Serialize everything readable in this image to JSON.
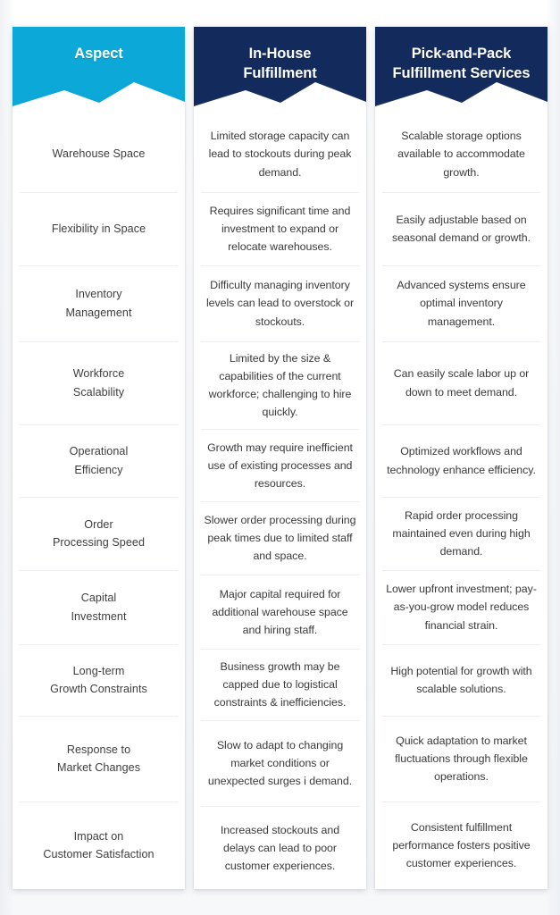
{
  "theme": {
    "aspect_header_color": "#0BA8D8",
    "compare_header_color": "#132B5C",
    "header_text_color": "#FFFFFF",
    "body_text_color": "#3A3A3C",
    "divider_color": "#ECEEF1",
    "card_background": "#FFFFFF",
    "page_background": "#FFFFFF"
  },
  "table": {
    "headers": [
      {
        "id": "aspect",
        "label": "Aspect",
        "style": "cyan"
      },
      {
        "id": "in-house-fulfillment",
        "label": "In-House\nFulfillment",
        "style": "navy"
      },
      {
        "id": "pick-and-pack-fulfillment-services",
        "label": "Pick-and-Pack\nFulfillment Services",
        "style": "navy"
      }
    ],
    "rows": [
      {
        "aspect": "Warehouse Space",
        "in_house": "Limited storage capacity can lead to stockouts during peak demand.",
        "pick_and_pack": "Scalable storage options available to accommodate growth."
      },
      {
        "aspect": "Flexibility in Space",
        "in_house": "Requires significant time and investment to expand or relocate warehouses.",
        "pick_and_pack": "Easily adjustable based on seasonal demand or growth."
      },
      {
        "aspect": "Inventory\nManagement",
        "in_house": "Difficulty managing inventory levels can lead to overstock or stockouts.",
        "pick_and_pack": "Advanced systems ensure optimal inventory management."
      },
      {
        "aspect": "Workforce\nScalability",
        "in_house": "Limited by the size & capabilities of the current workforce; challenging to hire quickly.",
        "pick_and_pack": "Can easily scale labor up or down to meet demand."
      },
      {
        "aspect": "Operational\nEfficiency",
        "in_house": "Growth may require inefficient use of existing processes and resources.",
        "pick_and_pack": "Optimized workflows and technology enhance efficiency."
      },
      {
        "aspect": "Order\nProcessing Speed",
        "in_house": "Slower order processing during peak times due to limited staff and space.",
        "pick_and_pack": "Rapid order processing maintained even during high demand."
      },
      {
        "aspect": "Capital\nInvestment",
        "in_house": "Major capital required for additional warehouse space and hiring staff.",
        "pick_and_pack": "Lower upfront investment; pay-as-you-grow model reduces financial strain."
      },
      {
        "aspect": "Long-term\nGrowth Constraints",
        "in_house": "Business growth may be capped due to logistical constraints & inefficiencies.",
        "pick_and_pack": "High potential for growth with scalable solutions."
      },
      {
        "aspect": "Response to\nMarket Changes",
        "in_house": "Slow to adapt to changing market conditions or unexpected surges i demand.",
        "pick_and_pack": "Quick adaptation to market fluctuations through flexible operations."
      },
      {
        "aspect": "Impact on\nCustomer Satisfaction",
        "in_house": "Increased stockouts and delays can lead to poor customer experiences.",
        "pick_and_pack": "Consistent fulfillment performance fosters positive customer experiences."
      }
    ]
  }
}
